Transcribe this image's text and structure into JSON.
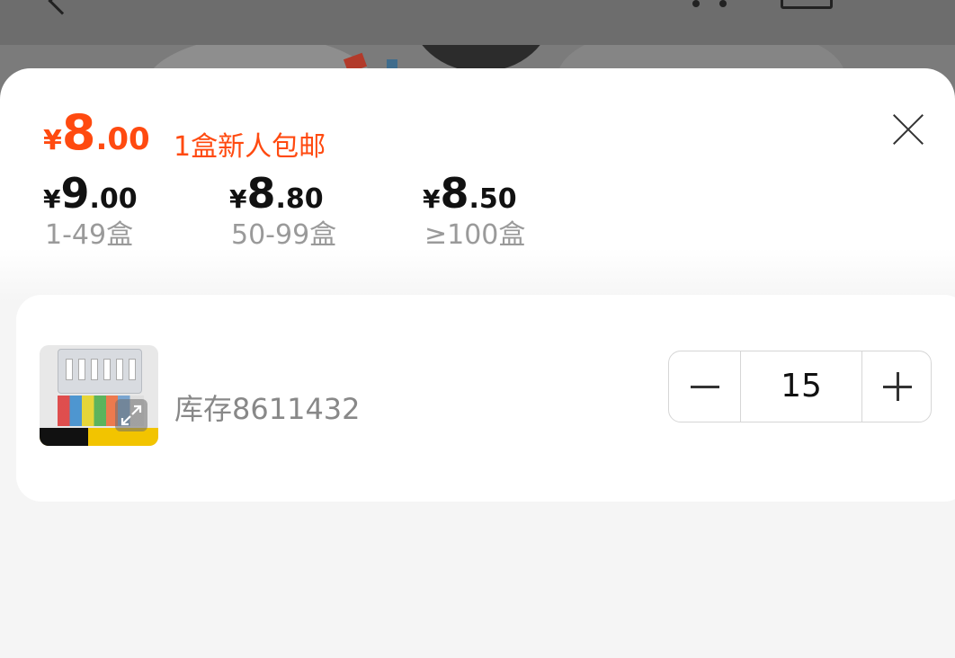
{
  "main_price": {
    "currency": "¥",
    "integer": "8",
    "decimal": ".00",
    "promo": "1盒新人包邮",
    "color": "#ff4a10"
  },
  "tiers": [
    {
      "currency": "¥",
      "integer": "9",
      "decimal": ".00",
      "range": "1-49盒"
    },
    {
      "currency": "¥",
      "integer": "8",
      "decimal": ".80",
      "range": "50-99盒"
    },
    {
      "currency": "¥",
      "integer": "8",
      "decimal": ".50",
      "range": "≥100盒"
    }
  ],
  "product": {
    "stock": "库存8611432",
    "thumbnail_icon": "expand-icon"
  },
  "quantity": {
    "value": "15",
    "minus_icon": "minus-icon",
    "plus_icon": "plus-icon"
  },
  "close_icon": "close-icon"
}
